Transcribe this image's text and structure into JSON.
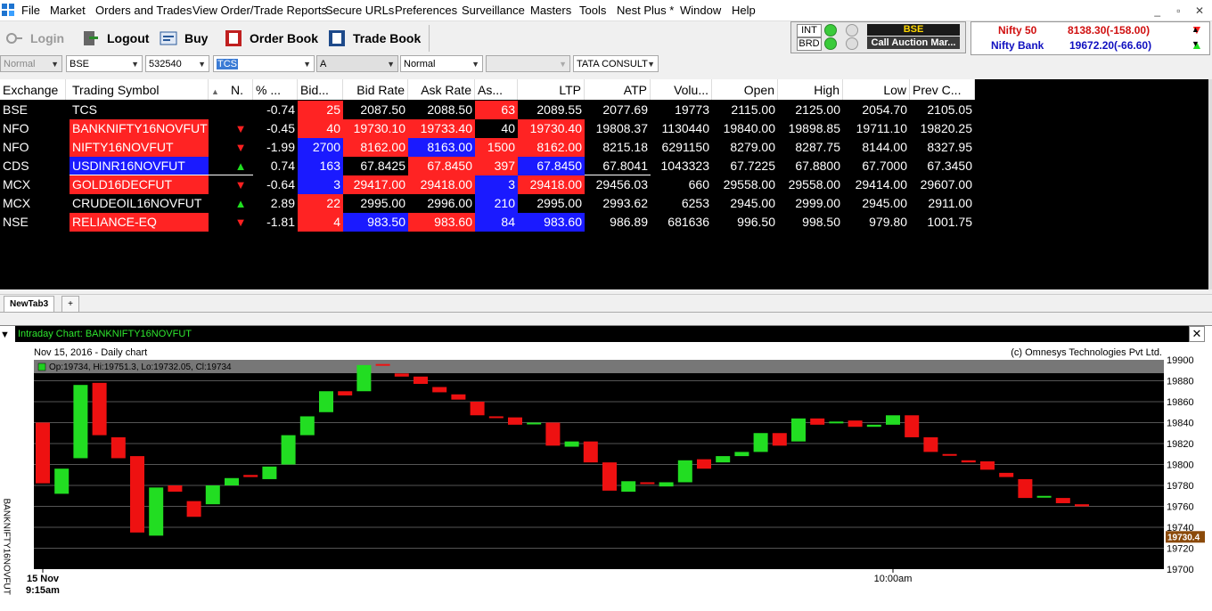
{
  "menu": [
    "File",
    "Market",
    "Orders and Trades",
    "View Order/Trade Reports",
    "Secure URLs",
    "Preferences",
    "Surveillance",
    "Masters",
    "Tools",
    "Nest Plus *",
    "Window",
    "Help"
  ],
  "window_controls": [
    "_",
    "▫",
    "✕"
  ],
  "toolbar": {
    "login": "Login",
    "logout": "Logout",
    "buy": "Buy",
    "order_book": "Order Book",
    "trade_book": "Trade Book"
  },
  "status_panel": {
    "int_label": "INT",
    "brd_label": "BRD",
    "exchange": "BSE",
    "session": "Call Auction Mar..."
  },
  "indices": [
    {
      "name": "Nifty 50",
      "value": "8138.30(-158.00)",
      "direction": "down"
    },
    {
      "name": "Nifty Bank",
      "value": "19672.20(-66.60)",
      "direction": "up"
    }
  ],
  "combos": {
    "mode": "Normal",
    "exchange": "BSE",
    "code": "532540",
    "symbol": "TCS",
    "series": "A",
    "order_type": "Normal",
    "blank": "",
    "company": "TATA CONSULT"
  },
  "columns": [
    "Exchange",
    "Trading Symbol",
    "N.",
    "% ...",
    "Bid...",
    "Bid Rate",
    "Ask Rate",
    "As...",
    "LTP",
    "ATP",
    "Volu...",
    "Open",
    "High",
    "Low",
    "Prev C..."
  ],
  "rows": [
    {
      "exchange": "BSE",
      "symbol": "TCS",
      "symbol_bg": "none",
      "arrow": "",
      "pct": "-0.74",
      "bid_qty": "25",
      "bid_qty_bg": "red",
      "bid_rate": "2087.50",
      "bid_rate_bg": "none",
      "ask_rate": "2088.50",
      "ask_rate_bg": "none",
      "ask_qty": "63",
      "ask_qty_bg": "red",
      "ltp": "2089.55",
      "ltp_bg": "none",
      "atp": "2077.69",
      "volume": "19773",
      "open": "2115.00",
      "high": "2125.00",
      "low": "2054.70",
      "prev_close": "2105.05"
    },
    {
      "exchange": "NFO",
      "symbol": "BANKNIFTY16NOVFUT",
      "symbol_bg": "red",
      "arrow": "down",
      "pct": "-0.45",
      "bid_qty": "40",
      "bid_qty_bg": "red",
      "bid_rate": "19730.10",
      "bid_rate_bg": "red",
      "ask_rate": "19733.40",
      "ask_rate_bg": "red",
      "ask_qty": "40",
      "ask_qty_bg": "none",
      "ltp": "19730.40",
      "ltp_bg": "red",
      "atp": "19808.37",
      "volume": "1130440",
      "open": "19840.00",
      "high": "19898.85",
      "low": "19711.10",
      "prev_close": "19820.25"
    },
    {
      "exchange": "NFO",
      "symbol": "NIFTY16NOVFUT",
      "symbol_bg": "red",
      "arrow": "down",
      "pct": "-1.99",
      "bid_qty": "2700",
      "bid_qty_bg": "blue",
      "bid_rate": "8162.00",
      "bid_rate_bg": "red",
      "ask_rate": "8163.00",
      "ask_rate_bg": "blue",
      "ask_qty": "1500",
      "ask_qty_bg": "red",
      "ltp": "8162.00",
      "ltp_bg": "red",
      "atp": "8215.18",
      "volume": "6291150",
      "open": "8279.00",
      "high": "8287.75",
      "low": "8144.00",
      "prev_close": "8327.95"
    },
    {
      "exchange": "CDS",
      "symbol": "USDINR16NOVFUT",
      "symbol_bg": "blue",
      "arrow": "up",
      "pct": "0.74",
      "bid_qty": "163",
      "bid_qty_bg": "blue",
      "bid_rate": "67.8425",
      "bid_rate_bg": "none",
      "ask_rate": "67.8450",
      "ask_rate_bg": "red",
      "ask_qty": "397",
      "ask_qty_bg": "red",
      "ltp": "67.8450",
      "ltp_bg": "blue",
      "atp": "67.8041",
      "volume": "1043323",
      "open": "67.7225",
      "high": "67.8800",
      "low": "67.7000",
      "prev_close": "67.3450"
    },
    {
      "exchange": "MCX",
      "symbol": "GOLD16DECFUT",
      "symbol_bg": "red",
      "arrow": "down",
      "pct": "-0.64",
      "bid_qty": "3",
      "bid_qty_bg": "blue",
      "bid_rate": "29417.00",
      "bid_rate_bg": "red",
      "ask_rate": "29418.00",
      "ask_rate_bg": "red",
      "ask_qty": "3",
      "ask_qty_bg": "blue",
      "ltp": "29418.00",
      "ltp_bg": "red",
      "atp": "29456.03",
      "volume": "660",
      "open": "29558.00",
      "high": "29558.00",
      "low": "29414.00",
      "prev_close": "29607.00"
    },
    {
      "exchange": "MCX",
      "symbol": "CRUDEOIL16NOVFUT",
      "symbol_bg": "none",
      "arrow": "up",
      "pct": "2.89",
      "bid_qty": "22",
      "bid_qty_bg": "red",
      "bid_rate": "2995.00",
      "bid_rate_bg": "none",
      "ask_rate": "2996.00",
      "ask_rate_bg": "none",
      "ask_qty": "210",
      "ask_qty_bg": "blue",
      "ltp": "2995.00",
      "ltp_bg": "none",
      "atp": "2993.62",
      "volume": "6253",
      "open": "2945.00",
      "high": "2999.00",
      "low": "2945.00",
      "prev_close": "2911.00"
    },
    {
      "exchange": "NSE",
      "symbol": "RELIANCE-EQ",
      "symbol_bg": "red",
      "arrow": "down",
      "pct": "-1.81",
      "bid_qty": "4",
      "bid_qty_bg": "red",
      "bid_rate": "983.50",
      "bid_rate_bg": "blue",
      "ask_rate": "983.60",
      "ask_rate_bg": "red",
      "ask_qty": "84",
      "ask_qty_bg": "blue",
      "ltp": "983.60",
      "ltp_bg": "blue",
      "atp": "986.89",
      "volume": "681636",
      "open": "996.50",
      "high": "998.50",
      "low": "979.80",
      "prev_close": "1001.75"
    }
  ],
  "tabs": {
    "active": "NewTab3",
    "add": "+"
  },
  "chart_panel": {
    "title": "Intraday Chart: BANKNIFTY16NOVFUT",
    "close": "✕",
    "side_label": "BANKNIFTY16NOVFUT"
  },
  "colors": {
    "up": "#20e020",
    "down": "#ff2020",
    "blue": "#1a1aff",
    "red": "#ff2323",
    "chart_bg": "#000000"
  },
  "chart_data": {
    "type": "candlestick",
    "subtitle": "Nov 15, 2016 - Daily chart",
    "copyright": "(c) Omnesys Technologies Pvt Ltd.",
    "ohlc_label": "Op:19734, Hi:19751.3, Lo:19732.05, Cl:19734",
    "ylim": [
      19700,
      19900
    ],
    "yticks": [
      19900,
      19880,
      19860,
      19840,
      19820,
      19800,
      19780,
      19760,
      19740,
      19720,
      19700
    ],
    "last_price_label": "19730.4",
    "last_price": 19730.4,
    "x_labels": [
      {
        "label": "15 Nov",
        "sub": "9:15am",
        "index": 0
      },
      {
        "label": "10:00am",
        "sub": "",
        "index": 45
      }
    ],
    "candles": [
      {
        "o": 19840,
        "c": 19782
      },
      {
        "o": 19772,
        "c": 19796
      },
      {
        "o": 19806,
        "c": 19876
      },
      {
        "o": 19878,
        "c": 19828
      },
      {
        "o": 19826,
        "c": 19806
      },
      {
        "o": 19808,
        "c": 19735
      },
      {
        "o": 19732,
        "c": 19778
      },
      {
        "o": 19780,
        "c": 19774
      },
      {
        "o": 19765,
        "c": 19750
      },
      {
        "o": 19762,
        "c": 19780
      },
      {
        "o": 19780,
        "c": 19787
      },
      {
        "o": 19790,
        "c": 19788
      },
      {
        "o": 19786,
        "c": 19798
      },
      {
        "o": 19800,
        "c": 19828
      },
      {
        "o": 19828,
        "c": 19846
      },
      {
        "o": 19850,
        "c": 19870
      },
      {
        "o": 19870,
        "c": 19866
      },
      {
        "o": 19870,
        "c": 19895
      },
      {
        "o": 19896,
        "c": 19895
      },
      {
        "o": 19887,
        "c": 19884
      },
      {
        "o": 19884,
        "c": 19877
      },
      {
        "o": 19874,
        "c": 19869
      },
      {
        "o": 19867,
        "c": 19862
      },
      {
        "o": 19860,
        "c": 19847
      },
      {
        "o": 19846,
        "c": 19845
      },
      {
        "o": 19845,
        "c": 19838
      },
      {
        "o": 19839,
        "c": 19840
      },
      {
        "o": 19840,
        "c": 19818
      },
      {
        "o": 19817,
        "c": 19822
      },
      {
        "o": 19822,
        "c": 19802
      },
      {
        "o": 19802,
        "c": 19775
      },
      {
        "o": 19774,
        "c": 19784
      },
      {
        "o": 19783,
        "c": 19782
      },
      {
        "o": 19779,
        "c": 19783
      },
      {
        "o": 19783,
        "c": 19804
      },
      {
        "o": 19805,
        "c": 19796
      },
      {
        "o": 19802,
        "c": 19808
      },
      {
        "o": 19808,
        "c": 19812
      },
      {
        "o": 19812,
        "c": 19830
      },
      {
        "o": 19830,
        "c": 19818
      },
      {
        "o": 19822,
        "c": 19844
      },
      {
        "o": 19844,
        "c": 19838
      },
      {
        "o": 19840,
        "c": 19841
      },
      {
        "o": 19842,
        "c": 19836
      },
      {
        "o": 19836,
        "c": 19838
      },
      {
        "o": 19838,
        "c": 19847
      },
      {
        "o": 19847,
        "c": 19826
      },
      {
        "o": 19826,
        "c": 19812
      },
      {
        "o": 19810,
        "c": 19809
      },
      {
        "o": 19804,
        "c": 19802
      },
      {
        "o": 19803,
        "c": 19795
      },
      {
        "o": 19792,
        "c": 19788
      },
      {
        "o": 19786,
        "c": 19768
      },
      {
        "o": 19769,
        "c": 19770
      },
      {
        "o": 19768,
        "c": 19763
      },
      {
        "o": 19762,
        "c": 19760
      }
    ]
  }
}
